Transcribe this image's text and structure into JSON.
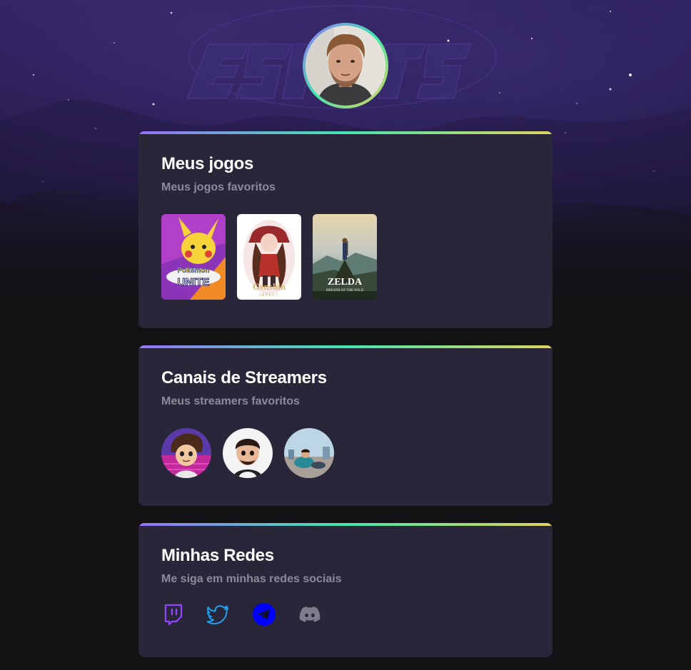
{
  "profile": {
    "avatar_alt": "profile photo"
  },
  "cards": {
    "games": {
      "title": "Meus jogos",
      "subtitle": "Meus jogos favoritos",
      "items": [
        {
          "icon": "pokemon-unite-cover",
          "logo_text": "UNITE"
        },
        {
          "icon": "genshin-impact-cover",
          "logo_text": "Genshin",
          "logo_sub": "IMPACT"
        },
        {
          "icon": "zelda-botw-cover",
          "logo_text": "ZELDA",
          "logo_sub": "BREATH OF THE WILD"
        }
      ]
    },
    "streamers": {
      "title": "Canais de Streamers",
      "subtitle": "Meus streamers favoritos",
      "items": [
        {
          "icon": "streamer-avatar-1"
        },
        {
          "icon": "streamer-avatar-2"
        },
        {
          "icon": "streamer-avatar-3"
        }
      ]
    },
    "socials": {
      "title": "Minhas Redes",
      "subtitle": "Me siga em minhas redes sociais",
      "items": [
        {
          "icon": "twitch-icon",
          "color": "#9146FF"
        },
        {
          "icon": "twitter-icon",
          "color": "#1DA1F2"
        },
        {
          "icon": "telegram-icon",
          "color": "#0000FF"
        },
        {
          "icon": "discord-icon",
          "color": "#7C7C8A"
        }
      ]
    }
  },
  "colors": {
    "background": "#121214",
    "card": "#29263a",
    "gradient_start": "#9572FC",
    "gradient_mid": "#43E7AD",
    "gradient_end": "#E2D45C",
    "subtitle": "#8c8a9a"
  }
}
